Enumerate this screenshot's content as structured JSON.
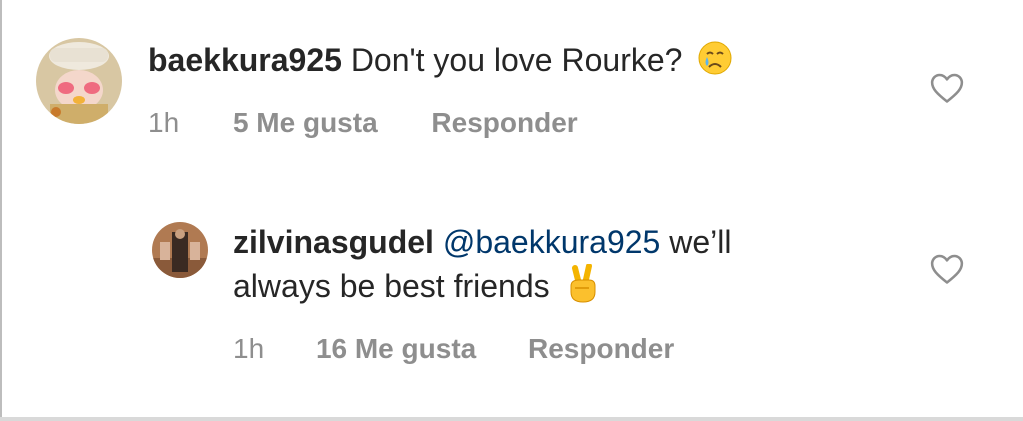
{
  "comments": [
    {
      "username": "baekkura925",
      "text": "Don't you love Rourke?",
      "emoji": "crying-face",
      "time": "1h",
      "likes": "5 Me gusta",
      "reply": "Responder"
    },
    {
      "username": "zilvinasgudel",
      "mention": "@baekkura925",
      "text_line1": "we’ll",
      "text_line2": "always be best friends",
      "emoji": "victory-hand",
      "time": "1h",
      "likes": "16 Me gusta",
      "reply": "Responder"
    }
  ],
  "colors": {
    "text": "#262626",
    "meta": "#8e8e8e",
    "mention": "#00376b"
  }
}
